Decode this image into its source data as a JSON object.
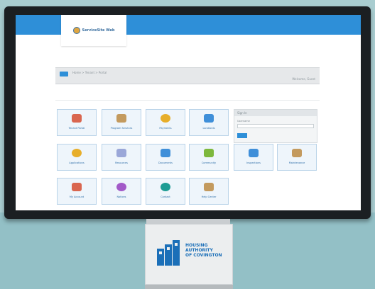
{
  "app": {
    "logo_text": "ServiceSite Web"
  },
  "nav": {
    "crumbs": "Home  >  Tenant  >  Portal",
    "right_text": "Welcome, Guest"
  },
  "tiles": [
    {
      "label": "Tenant Portal",
      "icon": "document-icon",
      "color": "#d9664f"
    },
    {
      "label": "Program Services",
      "icon": "building-icon",
      "color": "#c39a5e"
    },
    {
      "label": "Payments",
      "icon": "dollar-icon",
      "color": "#e7ae2a"
    },
    {
      "label": "Landlords",
      "icon": "people-icon",
      "color": "#3f8fd9"
    },
    {
      "label": "Applications",
      "icon": "coins-icon",
      "color": "#e7ae2a"
    },
    {
      "label": "Resources",
      "icon": "wrench-icon",
      "color": "#9aa7d8"
    },
    {
      "label": "Documents",
      "icon": "folder-icon",
      "color": "#3f8fd9"
    },
    {
      "label": "Community",
      "icon": "group-icon",
      "color": "#7db83c"
    },
    {
      "label": "Inspections",
      "icon": "people-icon",
      "color": "#3f8fd9"
    },
    {
      "label": "Maintenance",
      "icon": "box-icon",
      "color": "#c39a5e"
    },
    {
      "label": "My Account",
      "icon": "house-icon",
      "color": "#d9664f"
    },
    {
      "label": "Notices",
      "icon": "message-icon",
      "color": "#a35ac8"
    },
    {
      "label": "Contact",
      "icon": "info-icon",
      "color": "#1e9c94"
    },
    {
      "label": "Help Center",
      "icon": "building-icon",
      "color": "#c39a5e"
    }
  ],
  "login": {
    "title": "Sign In",
    "field_label": "Username",
    "placeholder": ""
  },
  "sign": {
    "line1": "HOUSING",
    "line2": "AUTHORITY",
    "line3": "OF COVINGTON"
  }
}
